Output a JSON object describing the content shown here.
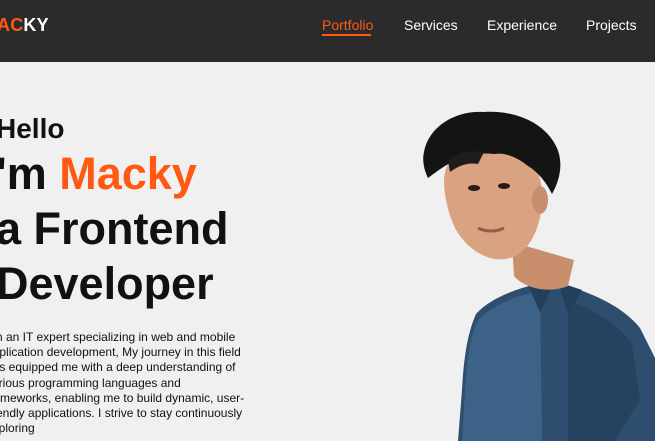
{
  "header": {
    "logo_accent": "AC",
    "logo_rest": "KY",
    "nav": [
      {
        "label": "Portfolio",
        "active": true
      },
      {
        "label": "Services",
        "active": false
      },
      {
        "label": "Experience",
        "active": false
      },
      {
        "label": "Projects",
        "active": false
      }
    ]
  },
  "hero": {
    "greeting": "Hello",
    "intro_prefix": "'m ",
    "name": "Macky",
    "role_line1": "a Frontend",
    "role_line2": "Developer",
    "bio": "am an IT expert specializing in web and mobile application development, My journey in this field has equipped me with a deep understanding of various programming languages and frameworks, enabling me to build dynamic, user-friendly applications. I strive to stay continuously exploring"
  },
  "colors": {
    "accent": "#ff5a14",
    "navbar_bg": "#2b2b2b",
    "page_bg": "#f0f0f0"
  }
}
